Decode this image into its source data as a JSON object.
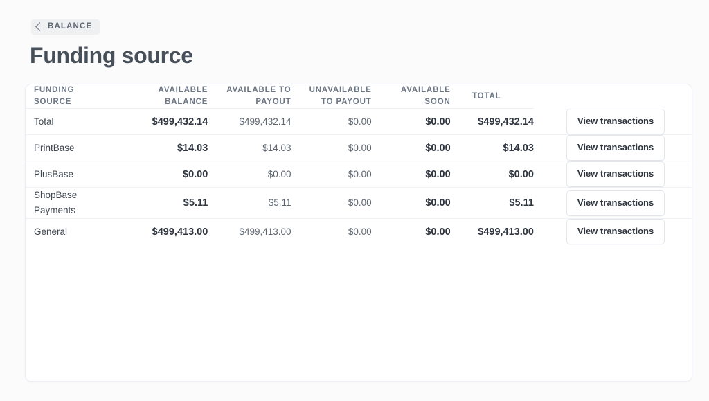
{
  "breadcrumb": {
    "icon": "chevron-left-icon",
    "label": "BALANCE"
  },
  "page_title": "Funding source",
  "table": {
    "columns": [
      {
        "key": "source",
        "label": "FUNDING SOURCE",
        "line1": "FUNDING",
        "line2": "SOURCE"
      },
      {
        "key": "avbal",
        "label": "AVAILABLE BALANCE",
        "line1": "AVAILABLE",
        "line2": "BALANCE"
      },
      {
        "key": "avpay",
        "label": "AVAILABLE TO PAYOUT",
        "line1": "AVAILABLE TO",
        "line2": "PAYOUT"
      },
      {
        "key": "unavpay",
        "label": "UNAVAILABLE TO PAYOUT",
        "line1": "UNAVAILABLE",
        "line2": "TO PAYOUT"
      },
      {
        "key": "avsoon",
        "label": "AVAILABLE SOON",
        "line1": "AVAILABLE",
        "line2": "SOON"
      },
      {
        "key": "total",
        "label": "TOTAL",
        "line1": "TOTAL",
        "line2": ""
      },
      {
        "key": "action",
        "label": "",
        "line1": "",
        "line2": ""
      }
    ],
    "action_button_label": "View transactions",
    "rows": [
      {
        "source": "Total",
        "available_balance": "$499,432.14",
        "available_to_payout": "$499,432.14",
        "unavailable_to_payout": "$0.00",
        "available_soon": "$0.00",
        "total": "$499,432.14",
        "action": "View transactions"
      },
      {
        "source": "PrintBase",
        "available_balance": "$14.03",
        "available_to_payout": "$14.03",
        "unavailable_to_payout": "$0.00",
        "available_soon": "$0.00",
        "total": "$14.03",
        "action": "View transactions"
      },
      {
        "source": "PlusBase",
        "available_balance": "$0.00",
        "available_to_payout": "$0.00",
        "unavailable_to_payout": "$0.00",
        "available_soon": "$0.00",
        "total": "$0.00",
        "action": "View transactions"
      },
      {
        "source": "ShopBase Payments",
        "available_balance": "$5.11",
        "available_to_payout": "$5.11",
        "unavailable_to_payout": "$0.00",
        "available_soon": "$0.00",
        "total": "$5.11",
        "action": "View transactions"
      },
      {
        "source": "General",
        "available_balance": "$499,413.00",
        "available_to_payout": "$499,413.00",
        "unavailable_to_payout": "$0.00",
        "available_soon": "$0.00",
        "total": "$499,413.00",
        "action": "View transactions"
      }
    ]
  },
  "colors": {
    "page_background": "#fbfbfc",
    "card_background": "#ffffff",
    "card_border": "#eceef3",
    "title_text": "#474f58",
    "header_text": "#6c7684",
    "value_strong": "#2f3640",
    "value_muted": "#5d6670",
    "breadcrumb_background": "#eef0f2",
    "row_divider": "#eff1f5"
  }
}
